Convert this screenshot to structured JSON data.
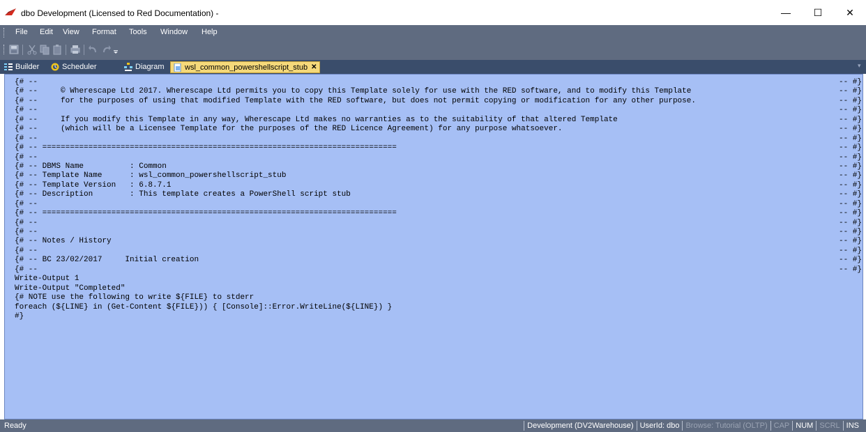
{
  "window": {
    "title": "dbo Development (Licensed to Red Documentation) -",
    "minimize_glyph": "—",
    "maximize_glyph": "☐",
    "close_glyph": "✕"
  },
  "menu": {
    "items": [
      "File",
      "Edit",
      "View",
      "Format",
      "Tools",
      "Window",
      "Help"
    ]
  },
  "toolbar": {
    "icons": [
      "save-icon",
      "cut-icon",
      "copy-icon",
      "paste-icon",
      "print-icon",
      "undo-icon",
      "redo-icon",
      "toolbar-options-icon"
    ]
  },
  "tabs": [
    {
      "label": "Builder",
      "icon": "builder-icon",
      "active": false
    },
    {
      "label": "Scheduler",
      "icon": "scheduler-icon",
      "active": false
    },
    {
      "label": "Diagram",
      "icon": "diagram-icon",
      "active": false
    },
    {
      "label": "wsl_common_powershellscript_stub",
      "icon": "script-file-icon",
      "active": true,
      "close_glyph": "✕"
    }
  ],
  "tab_dropdown_glyph": "▾",
  "editor": {
    "lines": [
      "{# --",
      "{# --     © Wherescape Ltd 2017. Wherescape Ltd permits you to copy this Template solely for use with the RED software, and to modify this Template",
      "{# --     for the purposes of using that modified Template with the RED software, but does not permit copying or modification for any other purpose.",
      "{# --",
      "{# --     If you modify this Template in any way, Wherescape Ltd makes no warranties as to the suitability of that altered Template",
      "{# --     (which will be a Licensee Template for the purposes of the RED Licence Agreement) for any purpose whatsoever.",
      "{# --",
      "{# -- =============================================================================",
      "{# --",
      "{# -- DBMS Name          : Common",
      "{# -- Template Name      : wsl_common_powershellscript_stub",
      "{# -- Template Version   : 6.8.7.1",
      "{# -- Description        : This template creates a PowerShell script stub",
      "{# --",
      "{# -- =============================================================================",
      "{# --",
      "{# --",
      "{# -- Notes / History",
      "{# --",
      "{# -- BC 23/02/2017     Initial creation",
      "{# --",
      "Write-Output 1",
      "Write-Output \"Completed\"",
      "{# NOTE use the following to write ${FILE} to stderr",
      "foreach (${LINE} in (Get-Content ${FILE})) { [Console]::Error.WriteLine(${LINE}) }",
      "#}"
    ],
    "right_marks": [
      "-- #}",
      "-- #}",
      "-- #}",
      "-- #}",
      "-- #}",
      "-- #}",
      "-- #}",
      "-- #}",
      "-- #}",
      "-- #}",
      "-- #}",
      "-- #}",
      "-- #}",
      "-- #}",
      "-- #}",
      "-- #}",
      "-- #}",
      "-- #}",
      "-- #}",
      "-- #}",
      "-- #}"
    ]
  },
  "status": {
    "left": "Ready",
    "panels": [
      {
        "text": "Development (DV2Warehouse)",
        "dim": false
      },
      {
        "text": "UserId: dbo",
        "dim": false
      },
      {
        "text": "Browse: Tutorial (OLTP)",
        "dim": true
      },
      {
        "text": "CAP",
        "dim": true
      },
      {
        "text": "NUM",
        "dim": false
      },
      {
        "text": "SCRL",
        "dim": true
      },
      {
        "text": "INS",
        "dim": false
      }
    ]
  },
  "colors": {
    "editor_background": "#a6bff5",
    "chrome": "#5f6b80",
    "tab_strip": "#3a4d6b",
    "active_tab": "#f5d97a"
  }
}
